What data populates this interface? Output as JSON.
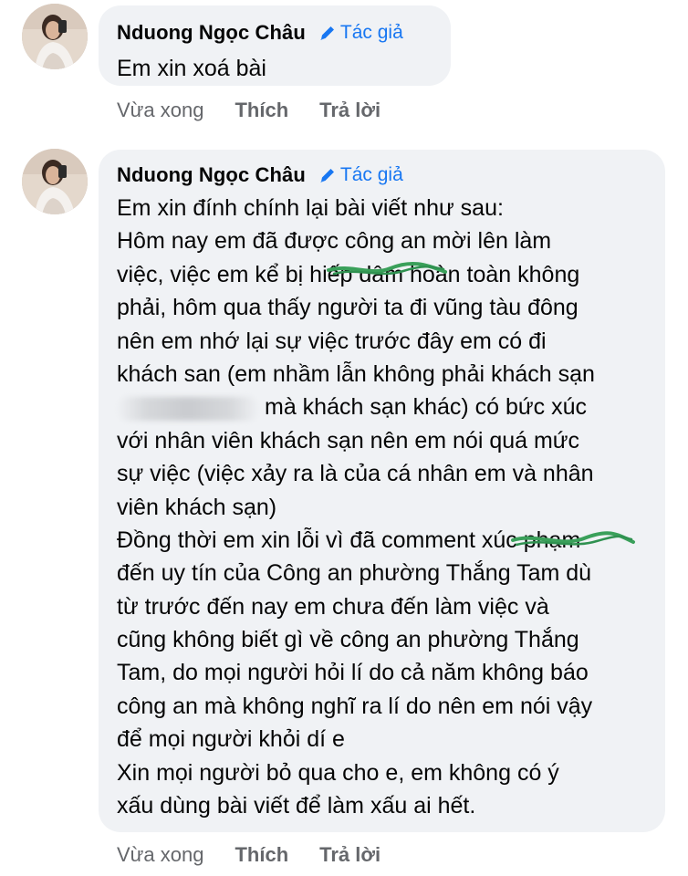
{
  "comments": [
    {
      "author": "Nduong Ngọc Châu",
      "badge": "Tác giả",
      "lines": [
        "Em xin xoá bài"
      ],
      "time": "Vừa xong",
      "like_label": "Thích",
      "reply_label": "Trả lời"
    },
    {
      "author": "Nduong Ngọc Châu",
      "badge": "Tác giả",
      "lines": [
        "Em xin đính chính lại bài viết như sau:",
        "Hôm nay em đã được công an mời lên làm",
        "việc, việc em kể bị hiếp dâm hoàn toàn không",
        "phải, hôm qua thấy người ta đi vũng tàu đông",
        "nên em nhớ lại sự việc trước đây em có đi",
        "khách san (em nhầm lẫn không phải khách sạn",
        "mà khách sạn khác) có bức xúc",
        "với nhân viên khách sạn nên em nói quá mức",
        "sự việc (việc xảy ra là của cá nhân em và nhân",
        "viên khách sạn)",
        "Đồng thời em xin lỗi vì đã comment xúc phạm",
        "đến uy tín của Công an phường Thắng Tam dù",
        "từ trước đến nay em chưa đến làm việc và",
        "cũng không biết gì về công an phường Thắng",
        "Tam, do mọi người hỏi lí do cả năm không báo",
        "công an mà không nghĩ ra lí do nên em nói vậy",
        "để mọi người khỏi dí e",
        "Xin mọi người bỏ qua cho e, em không có ý",
        "xấu dùng bài viết để làm xấu ai hết."
      ],
      "time": "Vừa xong",
      "like_label": "Thích",
      "reply_label": "Trả lời"
    }
  ],
  "colors": {
    "bubble": "#f0f2f5",
    "badge": "#1877f2",
    "meta": "#65676b",
    "scribble": "#3aa05a"
  }
}
